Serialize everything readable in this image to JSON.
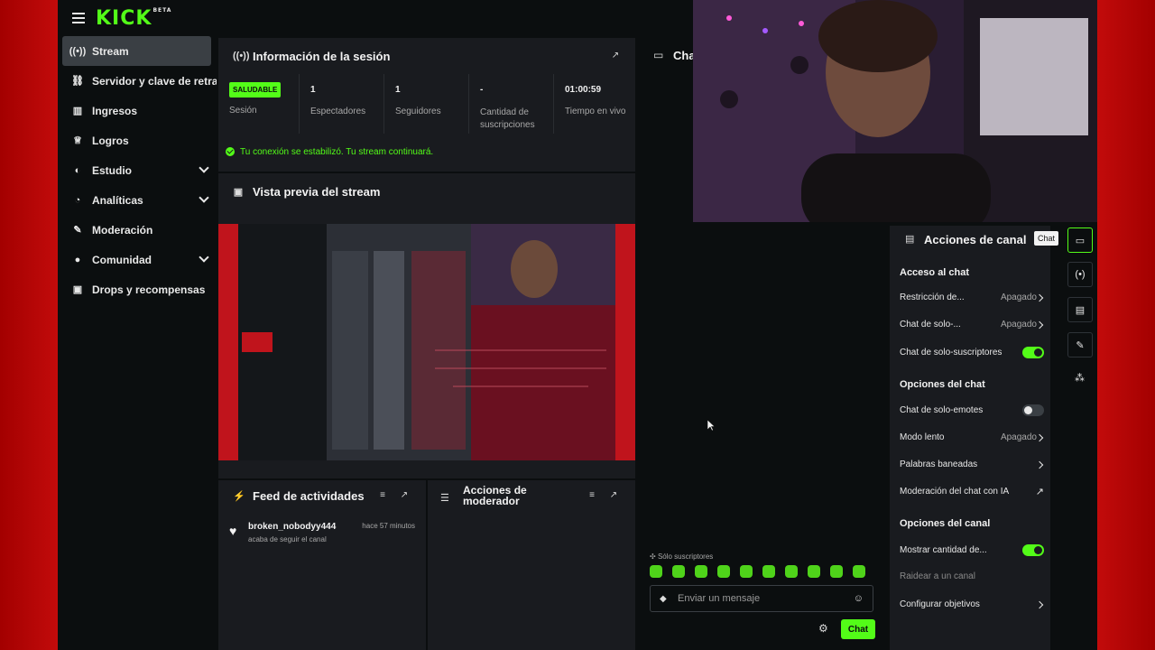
{
  "brand": {
    "logo": "KICK",
    "beta": "BETA"
  },
  "sidebar": {
    "items": [
      {
        "label": "Stream",
        "icon": "broadcast-icon"
      },
      {
        "label": "Servidor y clave de retransmisión",
        "icon": "link-icon"
      },
      {
        "label": "Ingresos",
        "icon": "chart-icon"
      },
      {
        "label": "Logros",
        "icon": "trophy-icon"
      },
      {
        "label": "Estudio",
        "icon": "palette-icon"
      },
      {
        "label": "Analíticas",
        "icon": "analytics-icon"
      },
      {
        "label": "Moderación",
        "icon": "wrench-icon"
      },
      {
        "label": "Comunidad",
        "icon": "community-icon"
      },
      {
        "label": "Drops y recompensas",
        "icon": "gift-icon"
      }
    ]
  },
  "session": {
    "title": "Información de la sesión",
    "stats": [
      {
        "value": "SALUDABLE",
        "label": "Sesión"
      },
      {
        "value": "1",
        "label": "Espectadores"
      },
      {
        "value": "1",
        "label": "Seguidores"
      },
      {
        "value": "-",
        "label": "Cantidad de suscripciones"
      },
      {
        "value": "01:00:59",
        "label": "Tiempo en vivo"
      }
    ],
    "notice": "Tu conexión se estabilizó. Tu stream continuará."
  },
  "preview": {
    "title": "Vista previa del stream"
  },
  "activity": {
    "title": "Feed de actividades",
    "items": [
      {
        "user": "broken_nobodyy444",
        "time": "hace 57 minutos",
        "text": "acaba de seguir el canal"
      }
    ]
  },
  "modactions": {
    "title": "Acciones de moderador"
  },
  "chat": {
    "title": "Chat",
    "sub_only": "Sólo suscriptores",
    "placeholder": "Enviar un mensaje",
    "send": "Chat"
  },
  "channel_actions": {
    "title": "Acciones de canal",
    "tooltip": "Chat",
    "sections": {
      "access": "Acceso al chat",
      "options": "Opciones del chat",
      "channel": "Opciones del canal"
    },
    "rows": {
      "restriccion": {
        "label": "Restricción de...",
        "value": "Apagado"
      },
      "chat_solo": {
        "label": "Chat de solo-...",
        "value": "Apagado"
      },
      "subs": {
        "label": "Chat de solo-suscriptores"
      },
      "emotes": {
        "label": "Chat de solo-emotes"
      },
      "lento": {
        "label": "Modo lento",
        "value": "Apagado"
      },
      "palabras": {
        "label": "Palabras baneadas"
      },
      "ia": {
        "label": "Moderación del chat con IA"
      },
      "mostrar": {
        "label": "Mostrar cantidad de..."
      },
      "raidear": {
        "label": "Raidear a un canal"
      },
      "objetivos": {
        "label": "Configurar objetivos"
      }
    }
  },
  "colors": {
    "accent": "#53fc18",
    "panel": "#191b1f",
    "background": "#0b0e0f",
    "frame": "#b00000"
  }
}
